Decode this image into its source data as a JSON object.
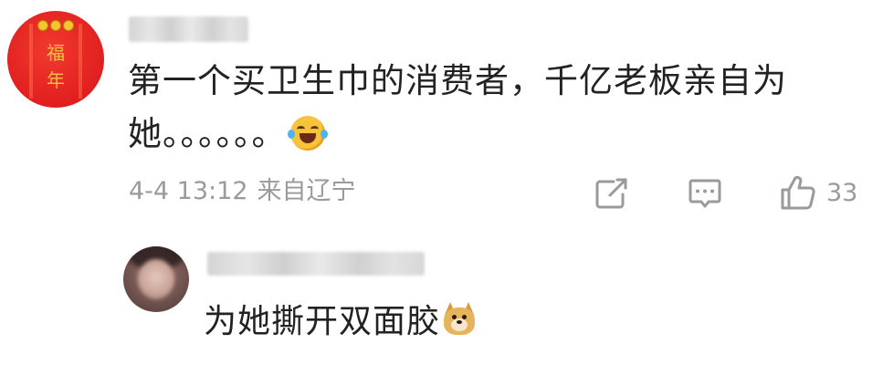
{
  "comment": {
    "avatar": {
      "icon": "fu-nian-avatar-icon",
      "char_top": "福",
      "char_bottom": "年",
      "color": "#e11f1f"
    },
    "text_main": "第一个买卫生巾的消费者，千亿老板亲自为她。。。。。。",
    "emoji": "laugh-cry-emoji",
    "date": "4-4 13:12",
    "location": "来自辽宁",
    "actions": {
      "share_icon": "share-icon",
      "comment_icon": "comment-icon",
      "like_icon": "thumbs-up-icon",
      "like_count": "33"
    }
  },
  "reply": {
    "avatar_icon": "user-avatar-icon",
    "text": "为她撕开双面胶",
    "emoji": "doge-emoji"
  },
  "colors": {
    "text": "#222222",
    "meta": "#9a9a9a"
  }
}
